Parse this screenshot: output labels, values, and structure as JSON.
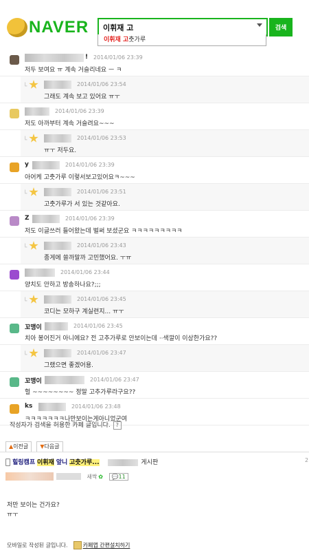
{
  "header": {
    "logo_text": "NAVER",
    "search_value": "이휘재 고",
    "search_button": "검색",
    "suggestion": {
      "highlight": "이휘재 고",
      "rest": "춧가루"
    }
  },
  "comments": [
    {
      "type": "comment",
      "avatar_color": "#6b5a4a",
      "nick": "",
      "nick_width": 86,
      "suffix": "!",
      "date": "2014/01/06 23:39",
      "text": "저두 보여요 ㅠ 계속 거슬리네요 ㅡ ㅋ"
    },
    {
      "type": "reply",
      "nick": "",
      "nick_width": 40,
      "date": "2014/01/06 23:54",
      "text": "그래도 계속 보고 있어요 ㅠㅜ"
    },
    {
      "type": "comment",
      "avatar_color": "#e8c960",
      "nick": "",
      "nick_width": 36,
      "suffix": "",
      "date": "2014/01/06 23:39",
      "text": "저도 아까부터 계속 거슬려요~~~"
    },
    {
      "type": "reply",
      "nick": "",
      "nick_width": 40,
      "date": "2014/01/06 23:53",
      "text": "ㅠㅜ 저두요."
    },
    {
      "type": "comment",
      "avatar_color": "#e8a326",
      "nick": "y",
      "nick_width": 40,
      "suffix": "",
      "date": "2014/01/06 23:39",
      "text": "아어케 고춧가루 이렇서보고있어요ㅋ~~~"
    },
    {
      "type": "reply",
      "nick": "",
      "nick_width": 40,
      "date": "2014/01/06 23:51",
      "text": "고춧가루가 서 있는 것같아요."
    },
    {
      "type": "comment",
      "avatar_color": "#b98ac7",
      "nick": "Z",
      "nick_width": 40,
      "suffix": "",
      "date": "2014/01/06 23:39",
      "text": "저도 이글쓰러 들어왔는데 벌써 보셨군요 ㅋㅋㅋㅋㅋㅋㅋㅋㅋ"
    },
    {
      "type": "reply",
      "nick": "",
      "nick_width": 40,
      "date": "2014/01/06 23:43",
      "text": "종게에 쓸까말까 고민했어요. ㅜㅠ"
    },
    {
      "type": "comment",
      "avatar_color": "#9b4bcf",
      "nick": "",
      "nick_width": 44,
      "suffix": "",
      "date": "2014/01/06 23:44",
      "text": "양치도 안하고 방송하나요?;;;"
    },
    {
      "type": "reply",
      "nick": "",
      "nick_width": 40,
      "date": "2014/01/06 23:45",
      "text": "코디는 모하구 계실련지... ㅠㅜ"
    },
    {
      "type": "comment",
      "avatar_color": "#59b889",
      "nick": "꼬맹이",
      "nick_width": 34,
      "suffix": "",
      "date": "2014/01/06 23:45",
      "text": "치아 봉어진거 아니에요? 전 고추가루로 안보이는데 ··색깔이 이상한가요??"
    },
    {
      "type": "reply",
      "nick": "",
      "nick_width": 40,
      "date": "2014/01/06 23:47",
      "text": "그랬으면 좋겠어용."
    },
    {
      "type": "comment",
      "avatar_color": "#59b889",
      "nick": "꼬맹이",
      "nick_width": 58,
      "suffix": "",
      "date": "2014/01/06 23:47",
      "text": "헐 ~~~~~~~~ 정말 고추가루라구요??"
    },
    {
      "type": "comment",
      "avatar_color": "#e8a326",
      "nick": "ks",
      "nick_width": 40,
      "suffix": "",
      "date": "2014/01/06 23:48",
      "text": "ㅋㅋㅋㅋㅋㅋㅋ나만보이는게아니었군여"
    }
  ],
  "footer": {
    "note": "작성자가 검색을 허용한 카페 글입니다.",
    "help": "?",
    "prev_btn": "이전글",
    "next_btn": "다음글",
    "post_title_prefix": "힐링캠프",
    "post_title_hl1": "이휘재",
    "post_title_mid": "앞니",
    "post_title_hl2": "고춧가루...",
    "board": "게시판",
    "side_num": "2",
    "meta_label": "새싹",
    "comment_count": "11",
    "body_line1": "저만 보이는 건가요?",
    "body_line2": "ㅠㅜ",
    "mobile_note": "모바일로 작성된 글입니다.",
    "cafe_app": "카페앱 간편설치하기"
  }
}
